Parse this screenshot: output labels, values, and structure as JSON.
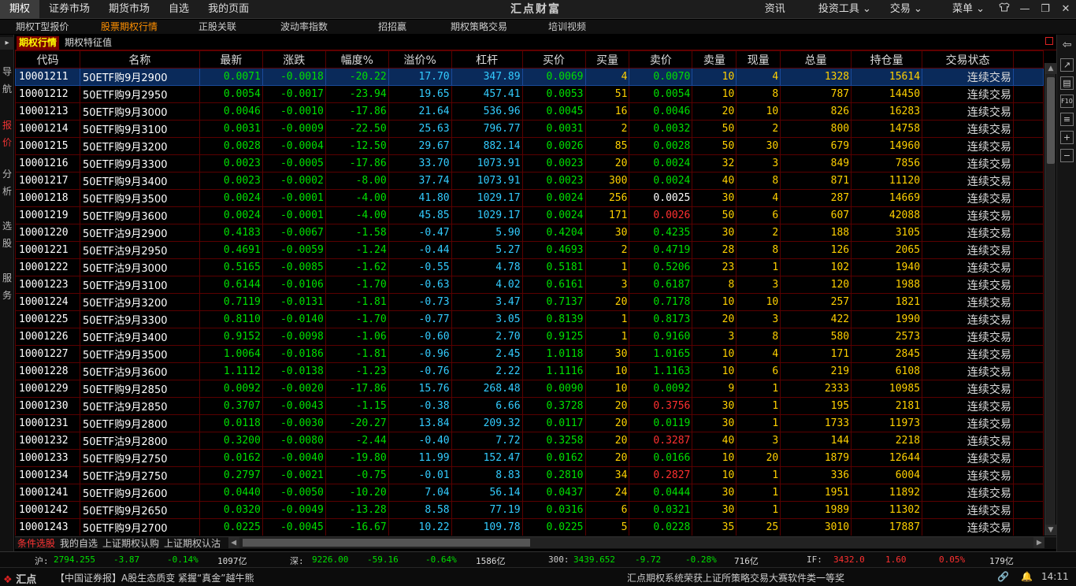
{
  "top_menu": [
    {
      "label": "期权",
      "active": true
    },
    {
      "label": "证券市场",
      "active": false
    },
    {
      "label": "期货市场",
      "active": false
    },
    {
      "label": "自选",
      "active": false
    },
    {
      "label": "我的页面",
      "active": false
    }
  ],
  "brand": "汇点财富",
  "right_menu": {
    "news": "资讯",
    "tools": "投资工具",
    "trade": "交易",
    "menu": "菜单"
  },
  "sub_tabs": [
    {
      "label": "期权T型报价",
      "active": false
    },
    {
      "label": "股票期权行情",
      "active": true
    },
    {
      "label": "正股关联",
      "active": false
    },
    {
      "label": "波动率指数",
      "active": false
    },
    {
      "label": "招招赢",
      "active": false
    },
    {
      "label": "期权策略交易",
      "active": false
    },
    {
      "label": "培训视频",
      "active": false
    }
  ],
  "left_nav": [
    {
      "label": "导航",
      "active": false
    },
    {
      "label": "报价",
      "active": true
    },
    {
      "label": "分析",
      "active": false
    },
    {
      "label": "选股",
      "active": false
    },
    {
      "label": "服务",
      "active": false
    }
  ],
  "panel_tabs": [
    {
      "label": "期权行情",
      "active": true
    },
    {
      "label": "期权特征值",
      "active": false
    }
  ],
  "table": {
    "columns": [
      "代码",
      "名称",
      "最新",
      "涨跌",
      "幅度%",
      "溢价%",
      "杠杆",
      "买价",
      "买量",
      "卖价",
      "卖量",
      "现量",
      "总量",
      "持仓量",
      "交易状态"
    ],
    "rows": [
      [
        "10001211",
        "50ETF购9月2900",
        "0.0071",
        "-0.0018",
        "-20.22",
        "17.70",
        "347.89",
        "0.0069",
        "4",
        "0.0070",
        "10",
        "4",
        "1328",
        "15614",
        "连续交易"
      ],
      [
        "10001212",
        "50ETF购9月2950",
        "0.0054",
        "-0.0017",
        "-23.94",
        "19.65",
        "457.41",
        "0.0053",
        "51",
        "0.0054",
        "10",
        "8",
        "787",
        "14450",
        "连续交易"
      ],
      [
        "10001213",
        "50ETF购9月3000",
        "0.0046",
        "-0.0010",
        "-17.86",
        "21.64",
        "536.96",
        "0.0045",
        "16",
        "0.0046",
        "20",
        "10",
        "826",
        "16283",
        "连续交易"
      ],
      [
        "10001214",
        "50ETF购9月3100",
        "0.0031",
        "-0.0009",
        "-22.50",
        "25.63",
        "796.77",
        "0.0031",
        "2",
        "0.0032",
        "50",
        "2",
        "800",
        "14758",
        "连续交易"
      ],
      [
        "10001215",
        "50ETF购9月3200",
        "0.0028",
        "-0.0004",
        "-12.50",
        "29.67",
        "882.14",
        "0.0026",
        "85",
        "0.0028",
        "50",
        "30",
        "679",
        "14960",
        "连续交易"
      ],
      [
        "10001216",
        "50ETF购9月3300",
        "0.0023",
        "-0.0005",
        "-17.86",
        "33.70",
        "1073.91",
        "0.0023",
        "20",
        "0.0024",
        "32",
        "3",
        "849",
        "7856",
        "连续交易"
      ],
      [
        "10001217",
        "50ETF购9月3400",
        "0.0023",
        "-0.0002",
        "-8.00",
        "37.74",
        "1073.91",
        "0.0023",
        "300",
        "0.0024",
        "40",
        "8",
        "871",
        "11120",
        "连续交易"
      ],
      [
        "10001218",
        "50ETF购9月3500",
        "0.0024",
        "-0.0001",
        "-4.00",
        "41.80",
        "1029.17",
        "0.0024",
        "256",
        "0.0025",
        "30",
        "4",
        "287",
        "14669",
        "连续交易"
      ],
      [
        "10001219",
        "50ETF购9月3600",
        "0.0024",
        "-0.0001",
        "-4.00",
        "45.85",
        "1029.17",
        "0.0024",
        "171",
        "0.0026",
        "50",
        "6",
        "607",
        "42088",
        "连续交易"
      ],
      [
        "10001220",
        "50ETF沽9月2900",
        "0.4183",
        "-0.0067",
        "-1.58",
        "-0.47",
        "5.90",
        "0.4204",
        "30",
        "0.4235",
        "30",
        "2",
        "188",
        "3105",
        "连续交易"
      ],
      [
        "10001221",
        "50ETF沽9月2950",
        "0.4691",
        "-0.0059",
        "-1.24",
        "-0.44",
        "5.27",
        "0.4693",
        "2",
        "0.4719",
        "28",
        "8",
        "126",
        "2065",
        "连续交易"
      ],
      [
        "10001222",
        "50ETF沽9月3000",
        "0.5165",
        "-0.0085",
        "-1.62",
        "-0.55",
        "4.78",
        "0.5181",
        "1",
        "0.5206",
        "23",
        "1",
        "102",
        "1940",
        "连续交易"
      ],
      [
        "10001223",
        "50ETF沽9月3100",
        "0.6144",
        "-0.0106",
        "-1.70",
        "-0.63",
        "4.02",
        "0.6161",
        "3",
        "0.6187",
        "8",
        "3",
        "120",
        "1988",
        "连续交易"
      ],
      [
        "10001224",
        "50ETF沽9月3200",
        "0.7119",
        "-0.0131",
        "-1.81",
        "-0.73",
        "3.47",
        "0.7137",
        "20",
        "0.7178",
        "10",
        "10",
        "257",
        "1821",
        "连续交易"
      ],
      [
        "10001225",
        "50ETF沽9月3300",
        "0.8110",
        "-0.0140",
        "-1.70",
        "-0.77",
        "3.05",
        "0.8139",
        "1",
        "0.8173",
        "20",
        "3",
        "422",
        "1990",
        "连续交易"
      ],
      [
        "10001226",
        "50ETF沽9月3400",
        "0.9152",
        "-0.0098",
        "-1.06",
        "-0.60",
        "2.70",
        "0.9125",
        "1",
        "0.9160",
        "3",
        "8",
        "580",
        "2573",
        "连续交易"
      ],
      [
        "10001227",
        "50ETF沽9月3500",
        "1.0064",
        "-0.0186",
        "-1.81",
        "-0.96",
        "2.45",
        "1.0118",
        "30",
        "1.0165",
        "10",
        "4",
        "171",
        "2845",
        "连续交易"
      ],
      [
        "10001228",
        "50ETF沽9月3600",
        "1.1112",
        "-0.0138",
        "-1.23",
        "-0.76",
        "2.22",
        "1.1116",
        "10",
        "1.1163",
        "10",
        "6",
        "219",
        "6108",
        "连续交易"
      ],
      [
        "10001229",
        "50ETF购9月2850",
        "0.0092",
        "-0.0020",
        "-17.86",
        "15.76",
        "268.48",
        "0.0090",
        "10",
        "0.0092",
        "9",
        "1",
        "2333",
        "10985",
        "连续交易"
      ],
      [
        "10001230",
        "50ETF沽9月2850",
        "0.3707",
        "-0.0043",
        "-1.15",
        "-0.38",
        "6.66",
        "0.3728",
        "20",
        "0.3756",
        "30",
        "1",
        "195",
        "2181",
        "连续交易"
      ],
      [
        "10001231",
        "50ETF购9月2800",
        "0.0118",
        "-0.0030",
        "-20.27",
        "13.84",
        "209.32",
        "0.0117",
        "20",
        "0.0119",
        "30",
        "1",
        "1733",
        "11973",
        "连续交易"
      ],
      [
        "10001232",
        "50ETF沽9月2800",
        "0.3200",
        "-0.0080",
        "-2.44",
        "-0.40",
        "7.72",
        "0.3258",
        "20",
        "0.3287",
        "40",
        "3",
        "144",
        "2218",
        "连续交易"
      ],
      [
        "10001233",
        "50ETF购9月2750",
        "0.0162",
        "-0.0040",
        "-19.80",
        "11.99",
        "152.47",
        "0.0162",
        "20",
        "0.0166",
        "10",
        "20",
        "1879",
        "12644",
        "连续交易"
      ],
      [
        "10001234",
        "50ETF沽9月2750",
        "0.2797",
        "-0.0021",
        "-0.75",
        "-0.01",
        "8.83",
        "0.2810",
        "34",
        "0.2827",
        "10",
        "1",
        "336",
        "6004",
        "连续交易"
      ],
      [
        "10001241",
        "50ETF购9月2600",
        "0.0440",
        "-0.0050",
        "-10.20",
        "7.04",
        "56.14",
        "0.0437",
        "24",
        "0.0444",
        "30",
        "1",
        "1951",
        "11892",
        "连续交易"
      ],
      [
        "10001242",
        "50ETF购9月2650",
        "0.0320",
        "-0.0049",
        "-13.28",
        "8.58",
        "77.19",
        "0.0316",
        "6",
        "0.0321",
        "30",
        "1",
        "1989",
        "11302",
        "连续交易"
      ],
      [
        "10001243",
        "50ETF购9月2700",
        "0.0225",
        "-0.0045",
        "-16.67",
        "10.22",
        "109.78",
        "0.0225",
        "5",
        "0.0228",
        "35",
        "25",
        "3010",
        "17887",
        "连续交易"
      ]
    ],
    "sell_colors": [
      "g",
      "g",
      "g",
      "g",
      "g",
      "g",
      "g",
      "w",
      "r",
      "g",
      "g",
      "g",
      "g",
      "g",
      "g",
      "g",
      "g",
      "g",
      "g",
      "r",
      "g",
      "r",
      "g",
      "r",
      "g",
      "g",
      "g"
    ]
  },
  "bottom_tabs": [
    {
      "label": "条件选股",
      "active": true
    },
    {
      "label": "我的自选",
      "active": false
    },
    {
      "label": "上证期权认购",
      "active": false
    },
    {
      "label": "上证期权认沽",
      "active": false
    }
  ],
  "status": {
    "sh_label": "沪:",
    "sh_val": "2794.255",
    "sh_chg": "-3.87",
    "sh_pct": "-0.14%",
    "sh_amt": "1097亿",
    "sz_label": "深:",
    "sz_val": "9226.00",
    "sz_chg": "-59.16",
    "sz_pct": "-0.64%",
    "sz_amt": "1586亿",
    "i300_label": "300:",
    "i300_val": "3439.652",
    "i300_chg": "-9.72",
    "i300_pct": "-0.28%",
    "i300_amt": "716亿",
    "if_label": "IF:",
    "if_val": "3432.0",
    "if_chg": "1.60",
    "if_pct": "0.05%",
    "if_amt": "179亿"
  },
  "news": {
    "logo": "汇点",
    "headline": "【中国证券报】A股生态质变 紧握“真金”越牛熊",
    "announce": "汇点期权系统荣获上证所策略交易大赛软件类一等奖",
    "time": "14:11"
  }
}
